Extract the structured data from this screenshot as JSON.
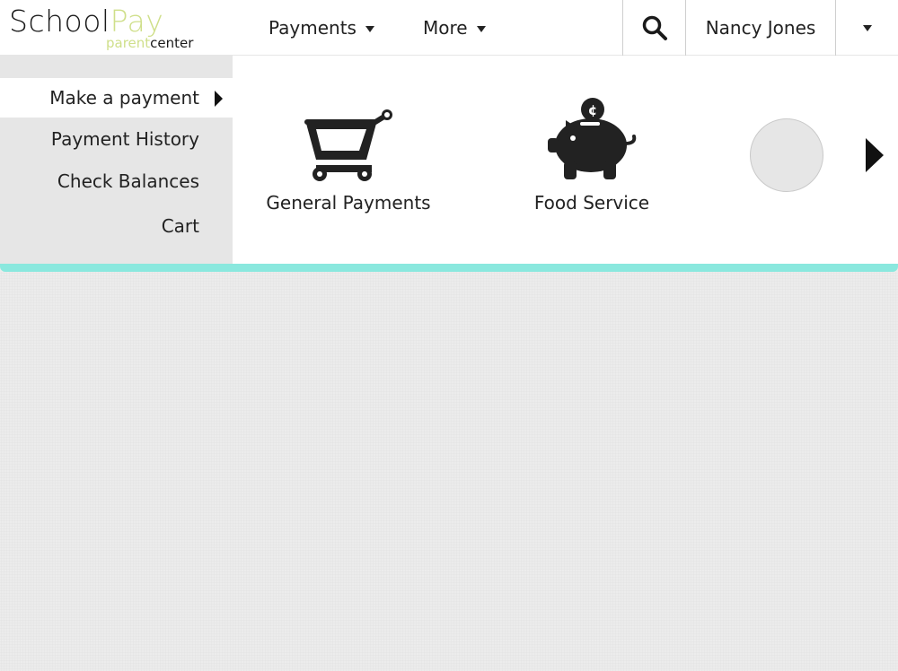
{
  "header": {
    "logo": {
      "school": "School",
      "pay": "Pay",
      "parent": "parent",
      "center": "center"
    },
    "nav": [
      {
        "label": "Payments"
      },
      {
        "label": "More"
      }
    ],
    "search_icon": "search-icon",
    "user": {
      "name": "Nancy Jones"
    }
  },
  "payments_menu": {
    "items": [
      {
        "label": "Make a payment",
        "active": true
      },
      {
        "label": "Payment History"
      },
      {
        "label": "Check Balances"
      },
      {
        "label": "Cart"
      }
    ],
    "tiles": [
      {
        "label": "General Payments",
        "icon": "shopping-cart-icon"
      },
      {
        "label": "Food Service",
        "icon": "piggy-bank-icon"
      }
    ]
  },
  "colors": {
    "logo_accent": "#cfdf8a",
    "accent_bar": "#8ae8de",
    "menu_bg": "#e6e6e6",
    "page_bg": "#ececec"
  }
}
